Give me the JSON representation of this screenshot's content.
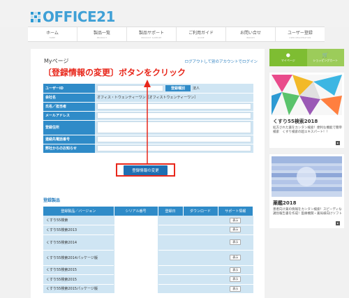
{
  "brand": {
    "name": "OFFICE21"
  },
  "nav": [
    {
      "label": "ホーム",
      "sub": "HOME"
    },
    {
      "label": "製品一覧",
      "sub": "PRODUCT"
    },
    {
      "label": "製品サポート",
      "sub": "PRODUCT SUPPORT"
    },
    {
      "label": "ご利用ガイド",
      "sub": "GUIDE"
    },
    {
      "label": "お問い合せ",
      "sub": "INQUIRY"
    },
    {
      "label": "ユーザー登録",
      "sub": "USER REGISTRATION"
    }
  ],
  "page": {
    "title": "Myページ",
    "logout_link": "ログアウトして別のアカウントでログイン",
    "annotation": "〔登録情報の変更〕ボタンをクリック",
    "change_button": "登録情報の変更"
  },
  "form": {
    "user_id_label": "ユーザーID",
    "reg_type_label": "登録種別",
    "reg_type_value": "法人",
    "company_label": "会社名",
    "company_value": "オフィス・トウェンティーワン［オフィストウェンティーワン］",
    "name_label": "氏名／担当者",
    "email_label": "メールアドレス",
    "address_label": "登録住所",
    "phone_label": "連絡先電話番号",
    "notice_label": "弊社からのお知らせ"
  },
  "products": {
    "section_title": "登録製品",
    "headers": [
      "登録製品／バージョン",
      "シリアル番号",
      "登録日",
      "ダウンロード",
      "サポート情報"
    ],
    "view_label": "表示",
    "rows": [
      "くすり55検索",
      "くすり55検索2013",
      "くすり55検索2014",
      "くすり55検索2014パッケージ版",
      "くすり55検索2015",
      "くすり55検索2015",
      "くすり55検索2015パッケージ版"
    ]
  },
  "sidebar": {
    "tab_mypage": "マイページ",
    "tab_cart": "ショッピングカート",
    "ad1": {
      "title": "くすり55検索2018",
      "desc": "処方された薬をカンタン検索！便利な機能で簡単検索　くすり検索の超エキスパート！！"
    },
    "ad2": {
      "title": "薬鑑2018",
      "desc": "患者向け薬の情報をカンタン検索！スピーディな識別報告書を作成！医療機関・薬局様向けソフト"
    }
  },
  "colors": {
    "accent_red": "#e8271b",
    "primary_blue": "#2f8bc8",
    "green": "#7ebd32"
  }
}
